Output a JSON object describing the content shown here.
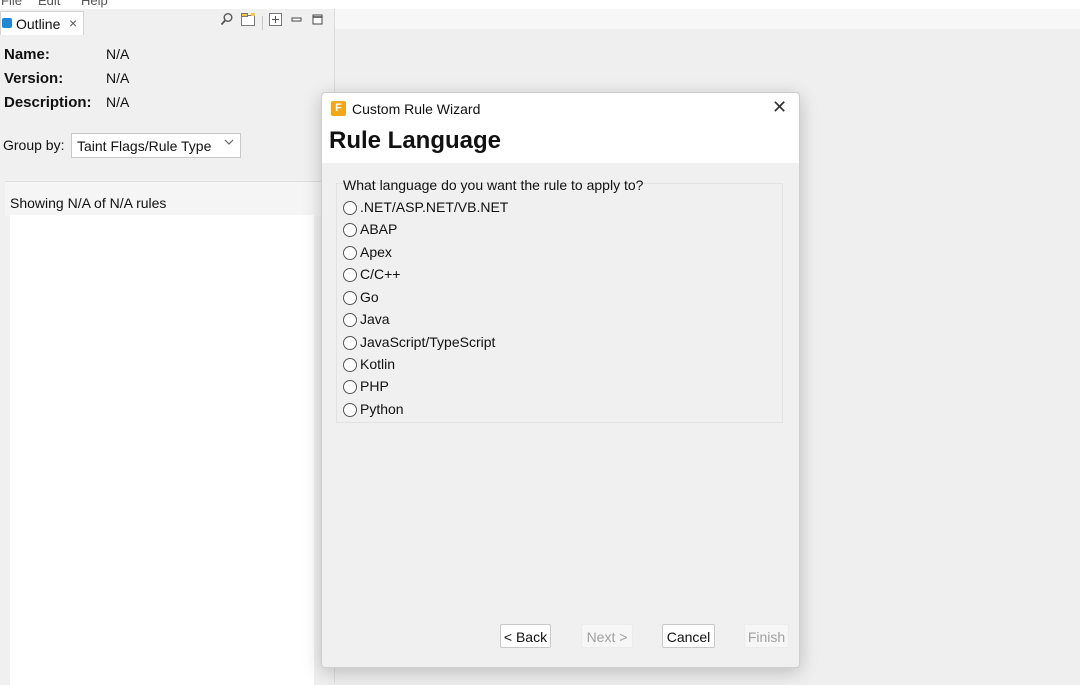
{
  "menubar": {
    "items": [
      "File",
      "Edit",
      "Help"
    ]
  },
  "outline": {
    "tab_label": "Outline",
    "tab_close": "×",
    "toolbar_icons": [
      "search-icon",
      "folder-icon",
      "expand-icon",
      "minimize-icon",
      "maximize-icon"
    ],
    "info": [
      {
        "label": "Name:",
        "value": "N/A"
      },
      {
        "label": "Version:",
        "value": "N/A"
      },
      {
        "label": "Description:",
        "value": "N/A"
      }
    ],
    "group_by_label": "Group by:",
    "group_by_value": "Taint Flags/Rule Type",
    "rules_summary": "Showing N/A of N/A rules"
  },
  "dialog": {
    "title": "Custom Rule Wizard",
    "app_icon_letter": "F",
    "close": "✕",
    "heading": "Rule Language",
    "question": "What language do you want the rule to apply to?",
    "languages": [
      ".NET/ASP.NET/VB.NET",
      "ABAP",
      "Apex",
      "C/C++",
      "Go",
      "Java",
      "JavaScript/TypeScript",
      "Kotlin",
      "PHP",
      "Python"
    ],
    "buttons": {
      "back": "< Back",
      "next": "Next >",
      "cancel": "Cancel",
      "finish": "Finish"
    }
  },
  "colors": {
    "app_icon": "#f2a71b",
    "outline_icon": "#1e88d6"
  }
}
